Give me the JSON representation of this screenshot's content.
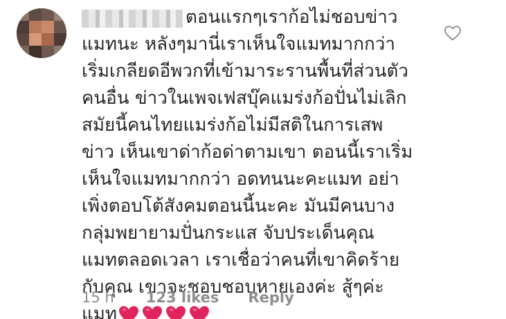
{
  "comment": {
    "lines": [
      "ตอนแรกๆเราก้อไม่ชอบข่าว",
      "แมทนะ หลังๆมานี่เราเห็นใจแมทมากกว่า",
      "เริ่มเกลียดอีพวกที่เข้ามาระรานพื้นที่ส่วนตัว",
      "คนอื่น ข่าวในเพจเฟสบุ๊คแมร่งก้อปั่นไม่เลิก",
      "สมัยนี้คนไทยแมร่งก้อไม่มีสติในการเสพ",
      "ข่าว เห็นเขาด่าก้อด่าตามเขา ตอนนี้เราเริ่ม",
      "เห็นใจแมทมากกว่า อดทนนะคะแมท อย่า",
      "เพิ่งตอบโต้สังคมตอนนี้นะคะ มันมีคนบาง",
      "กลุ่มพยายามปั่นกระแส  จับประเด็นคุณ",
      "แมทตลอดเวลา เราเชื่อว่าคนที่เขาคิดร้าย",
      "กับคุณ เขาจะชอบชอบหายเองค่ะ สู้ๆค่ะ",
      "แมท"
    ],
    "emoji": [
      "red-heart",
      "red-heart",
      "red-heart",
      "red-heart"
    ],
    "heart_color": "#e0245e",
    "like_icon": "heart-outline-icon"
  },
  "meta": {
    "time": "15 h",
    "likes": "123 likes",
    "reply": "Reply"
  }
}
